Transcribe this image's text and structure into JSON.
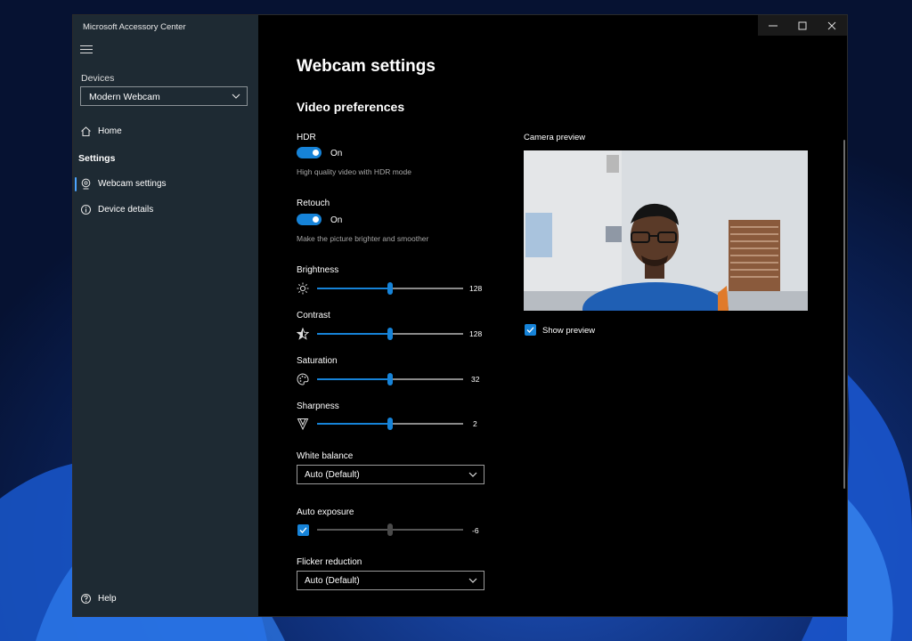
{
  "window": {
    "app_title": "Microsoft Accessory Center",
    "controls": {
      "minimize_icon": "minimize-icon",
      "maximize_icon": "maximize-icon",
      "close_icon": "close-icon"
    }
  },
  "sidebar": {
    "menu_icon": "hamburger-icon",
    "devices_label": "Devices",
    "device_selected": "Modern Webcam",
    "home_label": "Home",
    "settings_header": "Settings",
    "items": [
      {
        "label": "Webcam settings",
        "icon": "webcam-icon",
        "active": true
      },
      {
        "label": "Device details",
        "icon": "info-icon",
        "active": false
      }
    ],
    "help_label": "Help"
  },
  "main": {
    "page_title": "Webcam settings",
    "section_title": "Video preferences",
    "hdr": {
      "label": "HDR",
      "state": "On",
      "description": "High quality video with HDR mode"
    },
    "retouch": {
      "label": "Retouch",
      "state": "On",
      "description": "Make the picture brighter and smoother"
    },
    "brightness": {
      "label": "Brightness",
      "value": "128",
      "level": 0.5,
      "icon": "sun-icon"
    },
    "contrast": {
      "label": "Contrast",
      "value": "128",
      "level": 0.5,
      "icon": "contrast-star-icon"
    },
    "saturation": {
      "label": "Saturation",
      "value": "32",
      "level": 0.5,
      "icon": "palette-icon"
    },
    "sharpness": {
      "label": "Sharpness",
      "value": "2",
      "level": 0.5,
      "icon": "sharpness-icon"
    },
    "white_balance": {
      "label": "White balance",
      "selected": "Auto (Default)"
    },
    "auto_exposure": {
      "label": "Auto exposure",
      "value": "-6",
      "level": 0.5,
      "checked": true
    },
    "flicker_reduction": {
      "label": "Flicker reduction",
      "selected": "Auto (Default)"
    },
    "camera_preview": {
      "label": "Camera preview",
      "show_preview_label": "Show preview",
      "show_preview_checked": true
    }
  },
  "colors": {
    "accent": "#1683d8",
    "sidebar_bg": "#1e2a33",
    "content_bg": "#000000"
  }
}
